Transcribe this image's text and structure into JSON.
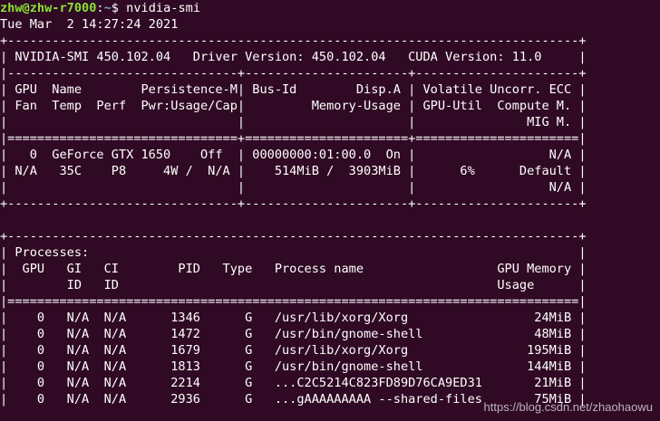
{
  "prompt": {
    "user_host": "zhw@zhw-r7000",
    "path": "~",
    "symbol": "$",
    "command": "nvidia-smi"
  },
  "terminal_lines": [
    "Tue Mar  2 14:27:24 2021",
    "+-----------------------------------------------------------------------------+",
    "| NVIDIA-SMI 450.102.04   Driver Version: 450.102.04   CUDA Version: 11.0     |",
    "|-------------------------------+----------------------+----------------------+",
    "| GPU  Name        Persistence-M| Bus-Id        Disp.A | Volatile Uncorr. ECC |",
    "| Fan  Temp  Perf  Pwr:Usage/Cap|         Memory-Usage | GPU-Util  Compute M. |",
    "|                               |                      |               MIG M. |",
    "|===============================+======================+======================|",
    "|   0  GeForce GTX 1650    Off  | 00000000:01:00.0  On |                  N/A |",
    "| N/A   35C    P8     4W /  N/A |    514MiB /  3903MiB |      6%      Default |",
    "|                               |                      |                  N/A |",
    "+-------------------------------+----------------------+----------------------+",
    "",
    "+-----------------------------------------------------------------------------+",
    "| Processes:                                                                  |",
    "|  GPU   GI   CI        PID   Type   Process name                  GPU Memory |",
    "|        ID   ID                                                   Usage      |",
    "|=============================================================================|",
    "|    0   N/A  N/A      1346      G   /usr/lib/xorg/Xorg                 24MiB |",
    "|    0   N/A  N/A      1472      G   /usr/bin/gnome-shell               48MiB |",
    "|    0   N/A  N/A      1679      G   /usr/lib/xorg/Xorg                195MiB |",
    "|    0   N/A  N/A      1813      G   /usr/bin/gnome-shell              144MiB |",
    "|    0   N/A  N/A      2214      G   ...C2C5214C823FD89D76CA9ED31       21MiB |",
    "|    0   N/A  N/A      2936      G   ...gAAAAAAAAA --shared-files       75MiB |"
  ],
  "watermark": "https://blog.csdn.net/zhaohaowu",
  "colors": {
    "background": "#300a24",
    "foreground": "#ffffff",
    "prompt_user": "#8ae234",
    "prompt_path": "#729fcf"
  }
}
